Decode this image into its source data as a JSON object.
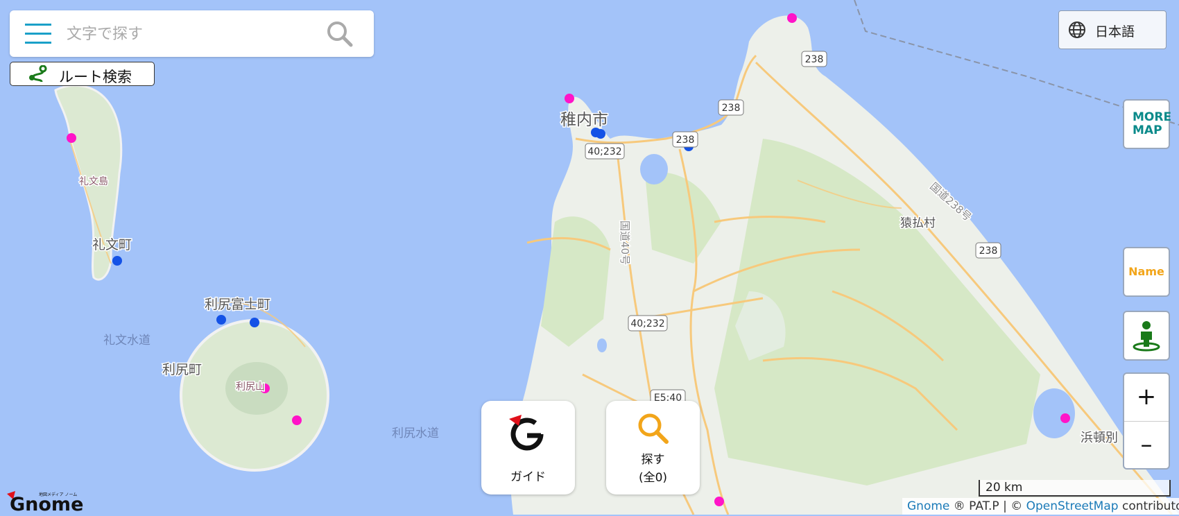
{
  "search": {
    "placeholder": "文字で探す"
  },
  "route_button": {
    "label": "ルート検索"
  },
  "language": {
    "label": "日本語"
  },
  "side_buttons": {
    "more_map": "MORE MAP",
    "name": "Name",
    "zoom_in": "+",
    "zoom_out": "–"
  },
  "cards": {
    "guide": "ガイド",
    "search_line1": "探す",
    "search_line2": "(全0)"
  },
  "scale": "20 km",
  "attribution": {
    "gnome": "Gnome",
    "mid": " ® PAT.P | © ",
    "osm": "OpenStreetMap",
    "tail": " contributors"
  },
  "logo": {
    "text": "Gnome",
    "small": "地図メディア ノーム"
  },
  "map_labels": {
    "wakkanai": "稚内市",
    "rebun_island": "礼文島",
    "rebun_town": "礼文町",
    "rishirifuji": "利尻富士町",
    "rebun_channel": "礼文水道",
    "rishiri_town": "利尻町",
    "rishiri_mt": "利尻山",
    "rishiri_channel": "利尻水道",
    "sarufutsu": "猿払村",
    "national_238": "国道238号",
    "national_40": "国道40号",
    "hamatonbetsu": "浜頓別",
    "shield_238a": "238",
    "shield_238b": "238",
    "shield_238c": "238",
    "shield_238d": "238",
    "shield_40_232a": "40;232",
    "shield_40_232b": "40;232",
    "shield_e540": "E5;40"
  },
  "colors": {
    "sea": "#a3c3f9",
    "land": "#f0f0f0",
    "forest": "#d4e7c5",
    "road": "#f7c97c",
    "poi_magenta": "#ff14c8",
    "poi_blue": "#1452e6"
  }
}
